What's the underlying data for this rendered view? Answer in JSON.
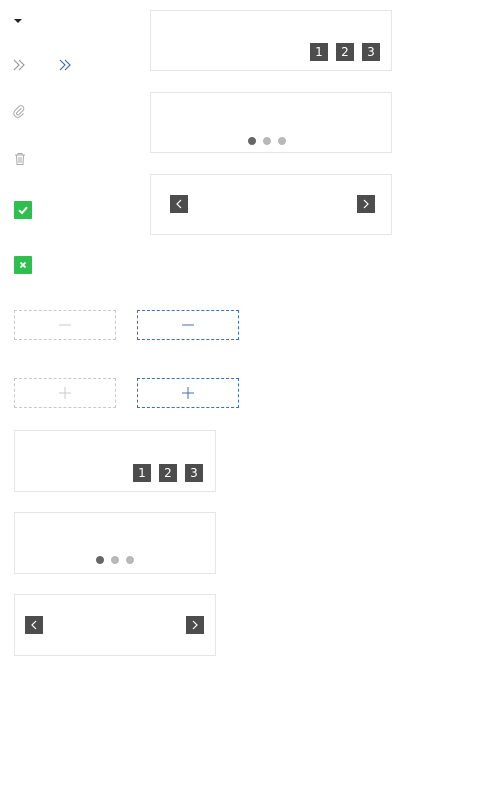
{
  "icons": {
    "dropdown": "caret-down-icon",
    "expand_inactive": "double-chevron-right-icon",
    "expand_active": "double-chevron-right-icon",
    "attach": "paperclip-icon",
    "delete": "trash-icon",
    "confirm": "check-icon",
    "cancel": "close-icon"
  },
  "colors": {
    "accent_blue": "#3f6fb3",
    "success_green": "#2ebf4f",
    "control_dark": "#4d4d4d",
    "border_light": "#e6e6e6"
  },
  "steppers": {
    "minus_label": "decrement",
    "plus_label": "increment"
  },
  "carousels": [
    {
      "pager": [
        "1",
        "2",
        "3"
      ]
    },
    {
      "pager": [
        "1",
        "2",
        "3"
      ]
    }
  ]
}
